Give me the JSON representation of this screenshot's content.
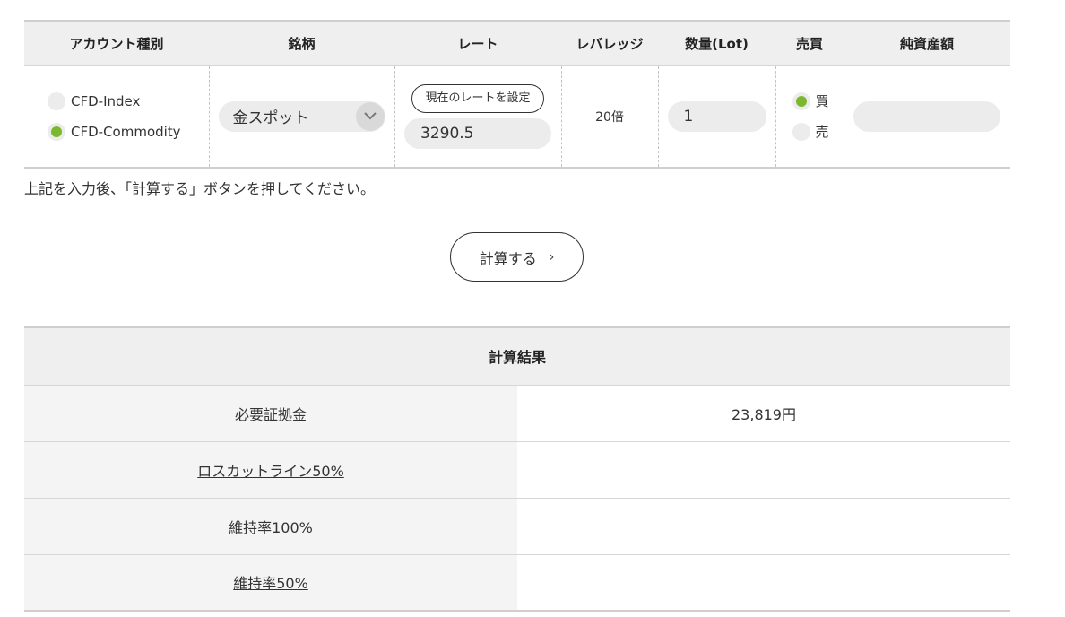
{
  "input_table": {
    "headers": [
      "アカウント種別",
      "銘柄",
      "レート",
      "レバレッジ",
      "数量(Lot)",
      "売買",
      "純資産額"
    ],
    "account_types": [
      {
        "label": "CFD-Index",
        "selected": false
      },
      {
        "label": "CFD-Commodity",
        "selected": true
      }
    ],
    "symbol": "金スポット",
    "rate_button": "現在のレートを設定",
    "rate_value": "3290.5",
    "leverage": "20倍",
    "lot": "1",
    "side": [
      {
        "label": "買",
        "selected": true
      },
      {
        "label": "売",
        "selected": false
      }
    ],
    "net_assets": ""
  },
  "note": "上記を入力後、「計算する」ボタンを押してください。",
  "calc_button": "計算する",
  "result": {
    "title": "計算結果",
    "rows": [
      {
        "label": "必要証拠金",
        "value": "23,819円"
      },
      {
        "label": "ロスカットライン50%",
        "value": ""
      },
      {
        "label": "維持率100%",
        "value": ""
      },
      {
        "label": "維持率50%",
        "value": ""
      }
    ]
  },
  "colors": {
    "accent_green": "#7cb82f",
    "header_bg": "#efefef",
    "pill_bg": "#ececec"
  }
}
